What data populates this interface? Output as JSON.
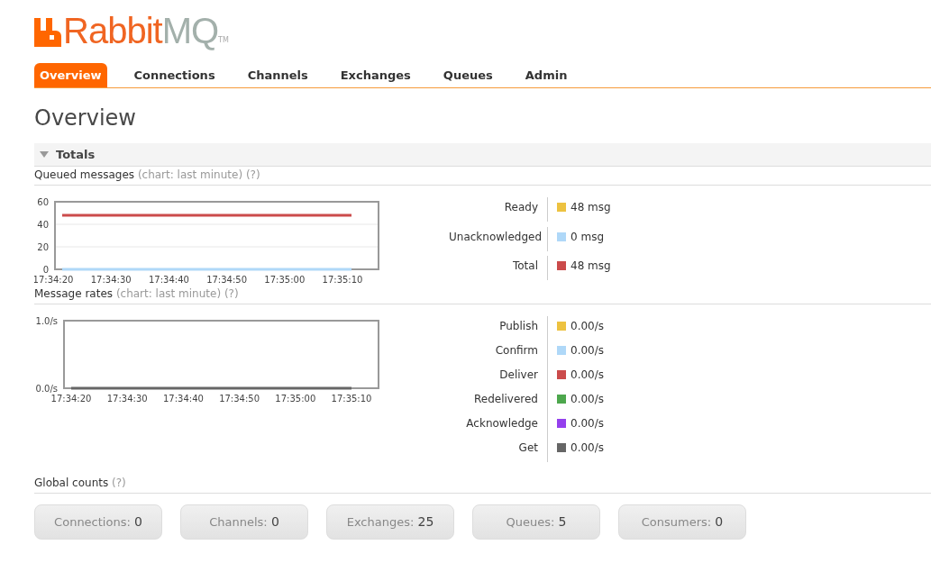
{
  "logo": {
    "brand": "Rabbit",
    "product": "MQ",
    "mark": "TM"
  },
  "tabs": [
    {
      "label": "Overview",
      "selected": true
    },
    {
      "label": "Connections",
      "selected": false
    },
    {
      "label": "Channels",
      "selected": false
    },
    {
      "label": "Exchanges",
      "selected": false
    },
    {
      "label": "Queues",
      "selected": false
    },
    {
      "label": "Admin",
      "selected": false
    }
  ],
  "page_title": "Overview",
  "totals": {
    "title": "Totals",
    "expanded": true
  },
  "queued": {
    "title": "Queued messages",
    "note": "(chart: last minute)",
    "help": "(?)",
    "chart_data": {
      "type": "line",
      "categories": [
        "17:34:20",
        "17:34:30",
        "17:34:40",
        "17:34:50",
        "17:35:00",
        "17:35:10"
      ],
      "ylim": [
        0,
        60
      ],
      "yticks": [
        0,
        20,
        40,
        60
      ],
      "series": [
        {
          "name": "Ready",
          "color": "#edc240",
          "values": [
            null,
            null,
            null,
            null,
            null,
            null
          ]
        },
        {
          "name": "Unacknowledged",
          "color": "#afd8f8",
          "values": [
            0,
            0,
            0,
            0,
            0,
            0
          ]
        },
        {
          "name": "Total",
          "color": "#cb4b4b",
          "values": [
            48,
            48,
            48,
            48,
            48,
            48
          ]
        }
      ]
    },
    "legend": [
      {
        "value": "48 msg"
      },
      {
        "value": "0 msg"
      },
      {
        "value": "48 msg"
      }
    ]
  },
  "rates": {
    "title": "Message rates",
    "note": "(chart: last minute)",
    "help": "(?)",
    "chart_data": {
      "type": "line",
      "categories": [
        "17:34:20",
        "17:34:30",
        "17:34:40",
        "17:34:50",
        "17:35:00",
        "17:35:10"
      ],
      "ylim": [
        0,
        1
      ],
      "yticks": [
        {
          "value": 0,
          "label": "0.0/s"
        },
        {
          "value": 1,
          "label": "1.0/s"
        }
      ],
      "series": [
        {
          "name": "Publish",
          "color": "#edc240",
          "values": [
            null,
            null,
            null,
            null,
            null,
            null
          ]
        },
        {
          "name": "Confirm",
          "color": "#afd8f8",
          "values": [
            null,
            null,
            null,
            null,
            null,
            null
          ]
        },
        {
          "name": "Deliver",
          "color": "#cb4b4b",
          "values": [
            null,
            null,
            null,
            null,
            null,
            null
          ]
        },
        {
          "name": "Redelivered",
          "color": "#4da74d",
          "values": [
            null,
            null,
            null,
            null,
            null,
            null
          ]
        },
        {
          "name": "Acknowledge",
          "color": "#9440ed",
          "values": [
            null,
            null,
            null,
            null,
            null,
            null
          ]
        },
        {
          "name": "Get",
          "color": "#666666",
          "values": [
            0,
            0,
            0,
            0,
            0,
            0
          ]
        }
      ]
    },
    "legend": [
      {
        "value": "0.00/s"
      },
      {
        "value": "0.00/s"
      },
      {
        "value": "0.00/s"
      },
      {
        "value": "0.00/s"
      },
      {
        "value": "0.00/s"
      },
      {
        "value": "0.00/s"
      }
    ]
  },
  "global_counts": {
    "title": "Global counts",
    "help": "(?)",
    "items": [
      {
        "label": "Connections:",
        "value": "0"
      },
      {
        "label": "Channels:",
        "value": "0"
      },
      {
        "label": "Exchanges:",
        "value": "25"
      },
      {
        "label": "Queues:",
        "value": "5"
      },
      {
        "label": "Consumers:",
        "value": "0"
      }
    ]
  }
}
